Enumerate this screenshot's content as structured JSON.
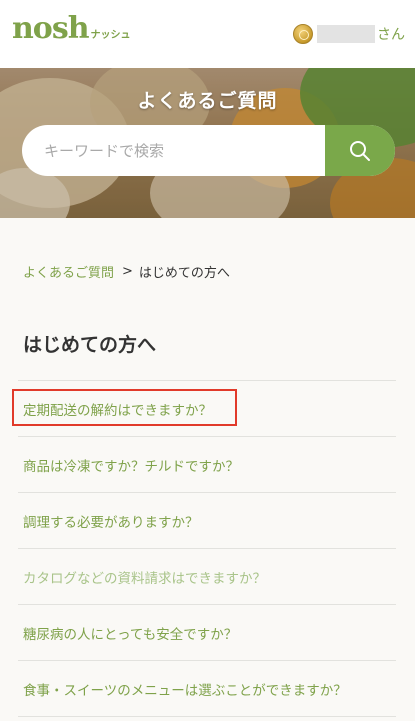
{
  "header": {
    "logo_word": "nosh",
    "logo_kana": "ナッシュ",
    "user_icon": "coin-icon",
    "user_suffix": "さん"
  },
  "hero": {
    "title": "よくあるご質問",
    "search": {
      "placeholder": "キーワードで検索",
      "button_icon": "search-icon"
    }
  },
  "breadcrumb": {
    "home_label": "よくあるご質問",
    "separator": ">",
    "current_label": "はじめての方へ"
  },
  "section": {
    "title": "はじめての方へ"
  },
  "faq": {
    "items": [
      {
        "label": "定期配送の解約はできますか？",
        "highlighted": true
      },
      {
        "label": "商品は冷凍ですか？チルドですか？"
      },
      {
        "label": "調理する必要がありますか？"
      },
      {
        "label": "カタログなどの資料請求はできますか？",
        "faded": true
      },
      {
        "label": "糖尿病の人にとっても安全ですか？"
      },
      {
        "label": "食事・スイーツのメニューは選ぶことができますか？"
      }
    ]
  },
  "colors": {
    "brand_green": "#7fa24a",
    "search_button": "#7aa84a",
    "highlight_red": "#e13a2a",
    "background": "#faf9f6"
  }
}
